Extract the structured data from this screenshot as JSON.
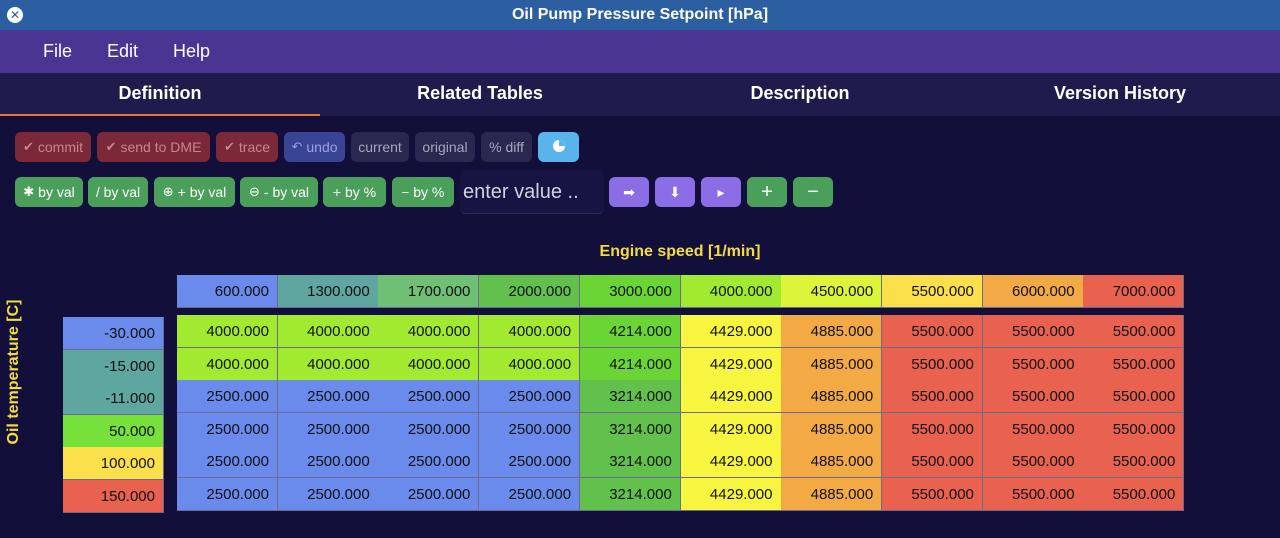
{
  "window": {
    "title": "Oil Pump Pressure Setpoint [hPa]"
  },
  "menu": {
    "file": "File",
    "edit": "Edit",
    "help": "Help"
  },
  "tabs": [
    "Definition",
    "Related Tables",
    "Description",
    "Version History"
  ],
  "toolbar1": {
    "commit": "commit",
    "send_to_dme": "send to DME",
    "trace": "trace",
    "undo": "undo",
    "current": "current",
    "original": "original",
    "pct_diff": "% diff"
  },
  "toolbar2": {
    "mul_by_val": "by val",
    "div_by_val": "/ by val",
    "plus_by_val": "+ by val",
    "minus_by_val": "- by val",
    "plus_by_pct": "+ by %",
    "minus_by_pct": "by %",
    "value_placeholder": "enter value .."
  },
  "axes": {
    "x_label": "Engine speed [1/min]",
    "y_label": "Oil temperature [C]"
  },
  "table": {
    "x_axis": [
      "600.000",
      "1300.000",
      "1700.000",
      "2000.000",
      "3000.000",
      "4000.000",
      "4500.000",
      "5500.000",
      "6000.000",
      "7000.000"
    ],
    "x_colors": [
      "#6a8bec",
      "#5fa5a0",
      "#6fc075",
      "#62c04d",
      "#6cd536",
      "#a2ea30",
      "#dcf538",
      "#fbe04b",
      "#f3aa45",
      "#e8624f"
    ],
    "y_axis": [
      "-30.000",
      "-15.000",
      "-11.000",
      "50.000",
      "100.000",
      "150.000"
    ],
    "y_colors": [
      "#6a8bec",
      "#5fa5a0",
      "#5fa5a0",
      "#76e13a",
      "#fbe04b",
      "#e8624f"
    ],
    "rows": [
      [
        "4000.000",
        "4000.000",
        "4000.000",
        "4000.000",
        "4214.000",
        "4429.000",
        "4885.000",
        "5500.000",
        "5500.000",
        "5500.000"
      ],
      [
        "4000.000",
        "4000.000",
        "4000.000",
        "4000.000",
        "4214.000",
        "4429.000",
        "4885.000",
        "5500.000",
        "5500.000",
        "5500.000"
      ],
      [
        "2500.000",
        "2500.000",
        "2500.000",
        "2500.000",
        "3214.000",
        "4429.000",
        "4885.000",
        "5500.000",
        "5500.000",
        "5500.000"
      ],
      [
        "2500.000",
        "2500.000",
        "2500.000",
        "2500.000",
        "3214.000",
        "4429.000",
        "4885.000",
        "5500.000",
        "5500.000",
        "5500.000"
      ],
      [
        "2500.000",
        "2500.000",
        "2500.000",
        "2500.000",
        "3214.000",
        "4429.000",
        "4885.000",
        "5500.000",
        "5500.000",
        "5500.000"
      ],
      [
        "2500.000",
        "2500.000",
        "2500.000",
        "2500.000",
        "3214.000",
        "4429.000",
        "4885.000",
        "5500.000",
        "5500.000",
        "5500.000"
      ]
    ],
    "cell_colors": {
      "2500.000": "#6a8bec",
      "4000.000": "#a2ea30",
      "3214.000": "#62c04d",
      "4214.000": "#6cd536",
      "4429.000": "#f7f540",
      "4885.000": "#f3aa45",
      "5500.000": "#e8624f"
    }
  }
}
